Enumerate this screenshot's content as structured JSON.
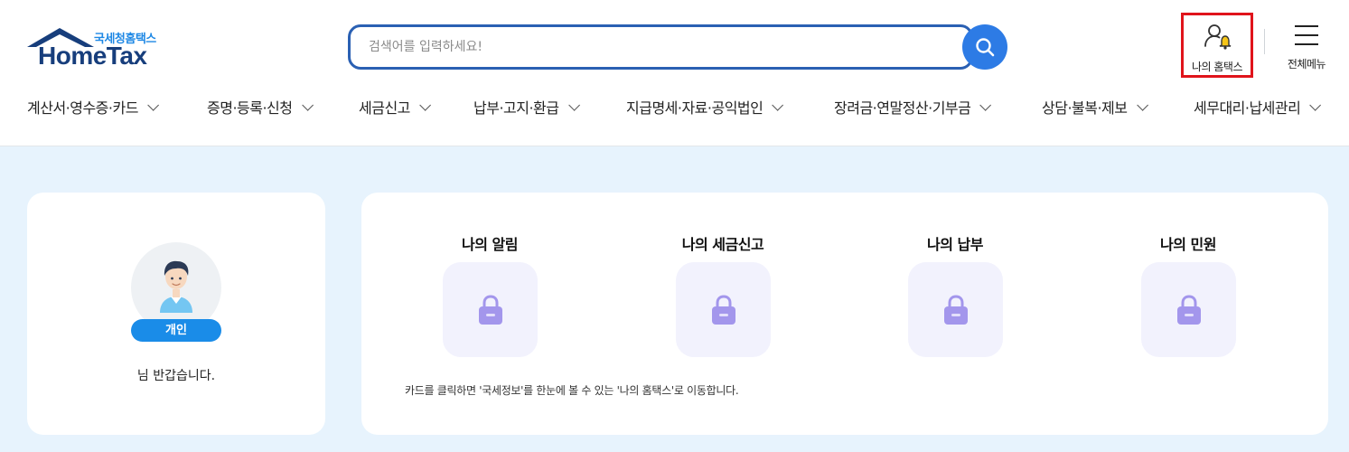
{
  "logo": {
    "subtitle": "국세청홈택스",
    "name": "HomeTax"
  },
  "search": {
    "placeholder": "검색어를 입력하세요!"
  },
  "header_actions": {
    "my_hometax": "나의 홈택스",
    "all_menu": "전체메뉴"
  },
  "nav": {
    "items": [
      {
        "label": "계산서·영수증·카드"
      },
      {
        "label": "증명·등록·신청"
      },
      {
        "label": "세금신고"
      },
      {
        "label": "납부·고지·환급"
      },
      {
        "label": "지급명세·자료·공익법인"
      },
      {
        "label": "장려금·연말정산·기부금"
      },
      {
        "label": "상담·불복·제보"
      },
      {
        "label": "세무대리·납세관리"
      }
    ]
  },
  "profile": {
    "badge": "개인",
    "greeting": "님 반갑습니다."
  },
  "tiles": [
    {
      "title": "나의 알림"
    },
    {
      "title": "나의 세금신고"
    },
    {
      "title": "나의 납부"
    },
    {
      "title": "나의 민원"
    }
  ],
  "tiles_note": "카드를 클릭하면 '국세정보'를 한눈에 볼 수 있는 '나의 홈택스'로 이동합니다.",
  "colors": {
    "accent": "#2d7be5",
    "brand_navy": "#173e7c",
    "highlight_box": "#e0141b",
    "lock": "#a396ec",
    "page_bg": "#e7f3fd"
  },
  "icons": {
    "search": "search-icon",
    "my_hometax": "user-bell-icon",
    "all_menu": "hamburger-icon",
    "tile": "lock-icon"
  }
}
